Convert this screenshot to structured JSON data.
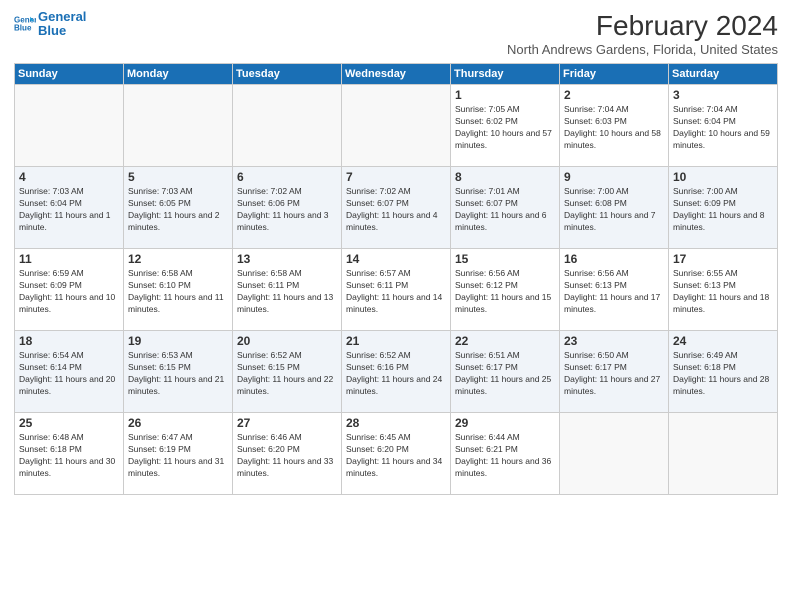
{
  "header": {
    "logo_line1": "General",
    "logo_line2": "Blue",
    "month": "February 2024",
    "location": "North Andrews Gardens, Florida, United States"
  },
  "weekdays": [
    "Sunday",
    "Monday",
    "Tuesday",
    "Wednesday",
    "Thursday",
    "Friday",
    "Saturday"
  ],
  "weeks": [
    [
      {
        "day": "",
        "empty": true
      },
      {
        "day": "",
        "empty": true
      },
      {
        "day": "",
        "empty": true
      },
      {
        "day": "",
        "empty": true
      },
      {
        "day": "1",
        "sunrise": "7:05 AM",
        "sunset": "6:02 PM",
        "daylight": "10 hours and 57 minutes."
      },
      {
        "day": "2",
        "sunrise": "7:04 AM",
        "sunset": "6:03 PM",
        "daylight": "10 hours and 58 minutes."
      },
      {
        "day": "3",
        "sunrise": "7:04 AM",
        "sunset": "6:04 PM",
        "daylight": "10 hours and 59 minutes."
      }
    ],
    [
      {
        "day": "4",
        "sunrise": "7:03 AM",
        "sunset": "6:04 PM",
        "daylight": "11 hours and 1 minute."
      },
      {
        "day": "5",
        "sunrise": "7:03 AM",
        "sunset": "6:05 PM",
        "daylight": "11 hours and 2 minutes."
      },
      {
        "day": "6",
        "sunrise": "7:02 AM",
        "sunset": "6:06 PM",
        "daylight": "11 hours and 3 minutes."
      },
      {
        "day": "7",
        "sunrise": "7:02 AM",
        "sunset": "6:07 PM",
        "daylight": "11 hours and 4 minutes."
      },
      {
        "day": "8",
        "sunrise": "7:01 AM",
        "sunset": "6:07 PM",
        "daylight": "11 hours and 6 minutes."
      },
      {
        "day": "9",
        "sunrise": "7:00 AM",
        "sunset": "6:08 PM",
        "daylight": "11 hours and 7 minutes."
      },
      {
        "day": "10",
        "sunrise": "7:00 AM",
        "sunset": "6:09 PM",
        "daylight": "11 hours and 8 minutes."
      }
    ],
    [
      {
        "day": "11",
        "sunrise": "6:59 AM",
        "sunset": "6:09 PM",
        "daylight": "11 hours and 10 minutes."
      },
      {
        "day": "12",
        "sunrise": "6:58 AM",
        "sunset": "6:10 PM",
        "daylight": "11 hours and 11 minutes."
      },
      {
        "day": "13",
        "sunrise": "6:58 AM",
        "sunset": "6:11 PM",
        "daylight": "11 hours and 13 minutes."
      },
      {
        "day": "14",
        "sunrise": "6:57 AM",
        "sunset": "6:11 PM",
        "daylight": "11 hours and 14 minutes."
      },
      {
        "day": "15",
        "sunrise": "6:56 AM",
        "sunset": "6:12 PM",
        "daylight": "11 hours and 15 minutes."
      },
      {
        "day": "16",
        "sunrise": "6:56 AM",
        "sunset": "6:13 PM",
        "daylight": "11 hours and 17 minutes."
      },
      {
        "day": "17",
        "sunrise": "6:55 AM",
        "sunset": "6:13 PM",
        "daylight": "11 hours and 18 minutes."
      }
    ],
    [
      {
        "day": "18",
        "sunrise": "6:54 AM",
        "sunset": "6:14 PM",
        "daylight": "11 hours and 20 minutes."
      },
      {
        "day": "19",
        "sunrise": "6:53 AM",
        "sunset": "6:15 PM",
        "daylight": "11 hours and 21 minutes."
      },
      {
        "day": "20",
        "sunrise": "6:52 AM",
        "sunset": "6:15 PM",
        "daylight": "11 hours and 22 minutes."
      },
      {
        "day": "21",
        "sunrise": "6:52 AM",
        "sunset": "6:16 PM",
        "daylight": "11 hours and 24 minutes."
      },
      {
        "day": "22",
        "sunrise": "6:51 AM",
        "sunset": "6:17 PM",
        "daylight": "11 hours and 25 minutes."
      },
      {
        "day": "23",
        "sunrise": "6:50 AM",
        "sunset": "6:17 PM",
        "daylight": "11 hours and 27 minutes."
      },
      {
        "day": "24",
        "sunrise": "6:49 AM",
        "sunset": "6:18 PM",
        "daylight": "11 hours and 28 minutes."
      }
    ],
    [
      {
        "day": "25",
        "sunrise": "6:48 AM",
        "sunset": "6:18 PM",
        "daylight": "11 hours and 30 minutes."
      },
      {
        "day": "26",
        "sunrise": "6:47 AM",
        "sunset": "6:19 PM",
        "daylight": "11 hours and 31 minutes."
      },
      {
        "day": "27",
        "sunrise": "6:46 AM",
        "sunset": "6:20 PM",
        "daylight": "11 hours and 33 minutes."
      },
      {
        "day": "28",
        "sunrise": "6:45 AM",
        "sunset": "6:20 PM",
        "daylight": "11 hours and 34 minutes."
      },
      {
        "day": "29",
        "sunrise": "6:44 AM",
        "sunset": "6:21 PM",
        "daylight": "11 hours and 36 minutes."
      },
      {
        "day": "",
        "empty": true
      },
      {
        "day": "",
        "empty": true
      }
    ]
  ]
}
